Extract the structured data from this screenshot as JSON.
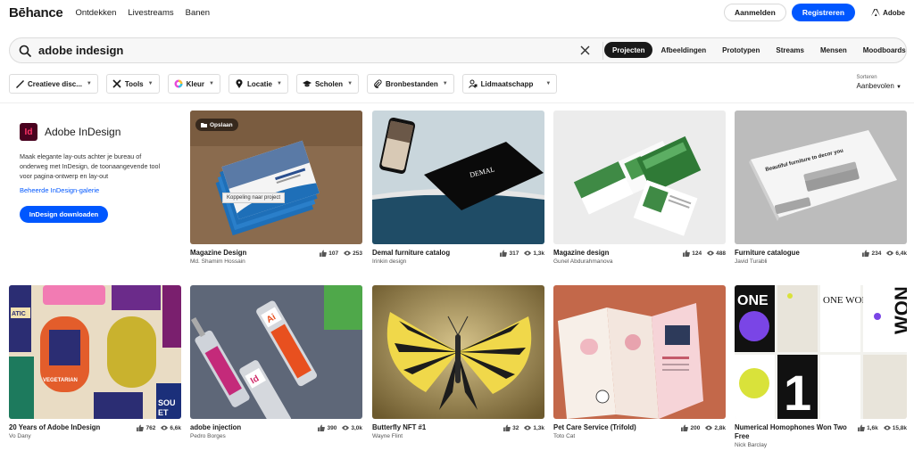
{
  "nav": {
    "logo": "Bēhance",
    "links": [
      "Ontdekken",
      "Livestreams",
      "Banen"
    ],
    "login": "Aanmelden",
    "register": "Registreren",
    "adobe": "Adobe"
  },
  "search": {
    "value": "adobe indesign",
    "tabs": [
      "Projecten",
      "Afbeeldingen",
      "Prototypen",
      "Streams",
      "Mensen",
      "Moodboards"
    ]
  },
  "filters": [
    "Creatieve disc...",
    "Tools",
    "Kleur",
    "Locatie",
    "Scholen",
    "Bronbestanden",
    "Lidmaatschapp"
  ],
  "sort": {
    "label": "Sorteren",
    "value": "Aanbevolen"
  },
  "sidebar": {
    "logo_letters": "Id",
    "title": "Adobe InDesign",
    "description": "Maak elegante lay-outs achter je bureau of onderweg met InDesign, de toonaangevende tool voor pagina-ontwerp en lay-out",
    "gallery_link": "Beheerde InDesign-galerie",
    "download": "InDesign downloaden"
  },
  "overlay": {
    "save": "Opslaan",
    "tooltip": "Koppeling naar project"
  },
  "cards": [
    {
      "title": "Magazine Design",
      "owner": "Md. Shamim Hossain",
      "likes": "107",
      "views": "253"
    },
    {
      "title": "Demal furniture catalog",
      "owner": "Irinkin design",
      "likes": "317",
      "views": "1,3k"
    },
    {
      "title": "Magazine design",
      "owner": "Gunel Abdurahmanova",
      "likes": "124",
      "views": "488"
    },
    {
      "title": "Furniture catalogue",
      "owner": "Javid Turabli",
      "likes": "234",
      "views": "6,4k"
    },
    {
      "title": "20 Years of Adobe InDesign",
      "owner": "Vo Dany",
      "likes": "762",
      "views": "6,6k"
    },
    {
      "title": "adobe injection",
      "owner": "Pedro Borges",
      "likes": "390",
      "views": "3,0k"
    },
    {
      "title": "Butterfly NFT #1",
      "owner": "Wayne Flint",
      "likes": "32",
      "views": "1,3k"
    },
    {
      "title": "Pet Care Service (Trifold)",
      "owner": "Toto Cat",
      "likes": "200",
      "views": "2,8k"
    },
    {
      "title": "Numerical Homophones Won Two Free",
      "owner": "Nick Barclay",
      "likes": "1,6k",
      "views": "15,8k"
    }
  ],
  "thumb_text": {
    "demal": "DEMAL",
    "furniture": "Beautiful furniture to decor you",
    "one": "ONE",
    "won": "WON",
    "one_small": "ONE WON",
    "ai": "Ai",
    "id": "Id",
    "quatic": "ATIC",
    "vegetarian": "VEGETARIAN",
    "sou": "SOU",
    "et": "ET"
  },
  "colors": {
    "accent": "#0057ff",
    "indesign_bg": "#49021f",
    "indesign_fg": "#ff3366"
  }
}
